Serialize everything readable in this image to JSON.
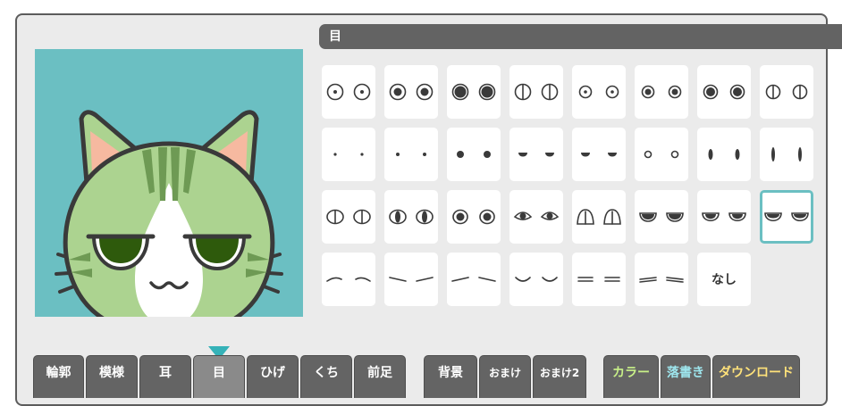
{
  "panel": {
    "title": "目"
  },
  "eye_options": [
    {
      "label": ""
    },
    {
      "label": ""
    },
    {
      "label": ""
    },
    {
      "label": ""
    },
    {
      "label": ""
    },
    {
      "label": ""
    },
    {
      "label": ""
    },
    {
      "label": ""
    },
    {
      "label": ""
    },
    {
      "label": ""
    },
    {
      "label": ""
    },
    {
      "label": ""
    },
    {
      "label": ""
    },
    {
      "label": ""
    },
    {
      "label": ""
    },
    {
      "label": ""
    },
    {
      "label": ""
    },
    {
      "label": ""
    },
    {
      "label": ""
    },
    {
      "label": ""
    },
    {
      "label": ""
    },
    {
      "label": ""
    },
    {
      "label": ""
    },
    {
      "label": ""
    },
    {
      "label": ""
    },
    {
      "label": ""
    },
    {
      "label": ""
    },
    {
      "label": ""
    },
    {
      "label": ""
    },
    {
      "label": ""
    },
    {
      "label": "なし"
    }
  ],
  "selected_option": 23,
  "tabs": [
    {
      "label": "輪郭"
    },
    {
      "label": "模様"
    },
    {
      "label": "耳"
    },
    {
      "label": "目"
    },
    {
      "label": "ひげ"
    },
    {
      "label": "くち"
    },
    {
      "label": "前足"
    },
    {
      "label": "背景"
    },
    {
      "label": "おまけ"
    },
    {
      "label": "おまけ2"
    },
    {
      "label": "カラー"
    },
    {
      "label": "落書き"
    },
    {
      "label": "ダウンロード"
    }
  ],
  "active_tab": 3,
  "colors": {
    "accent": "#6bbfc2",
    "indicator": "#35b2b8",
    "tab_bg": "#646464",
    "color_tab_text": "#c8f088",
    "graffiti_tab_text": "#9ee6ee",
    "download_tab_text": "#ffe27a",
    "cat_fur": "#acd390",
    "cat_stripe": "#6e9a54",
    "cat_eye": "#2e5a0c",
    "ear_inner": "#f6b9a0"
  },
  "icons": {
    "preview": "cat-face-preview",
    "indicator": "triangle-down-icon"
  }
}
